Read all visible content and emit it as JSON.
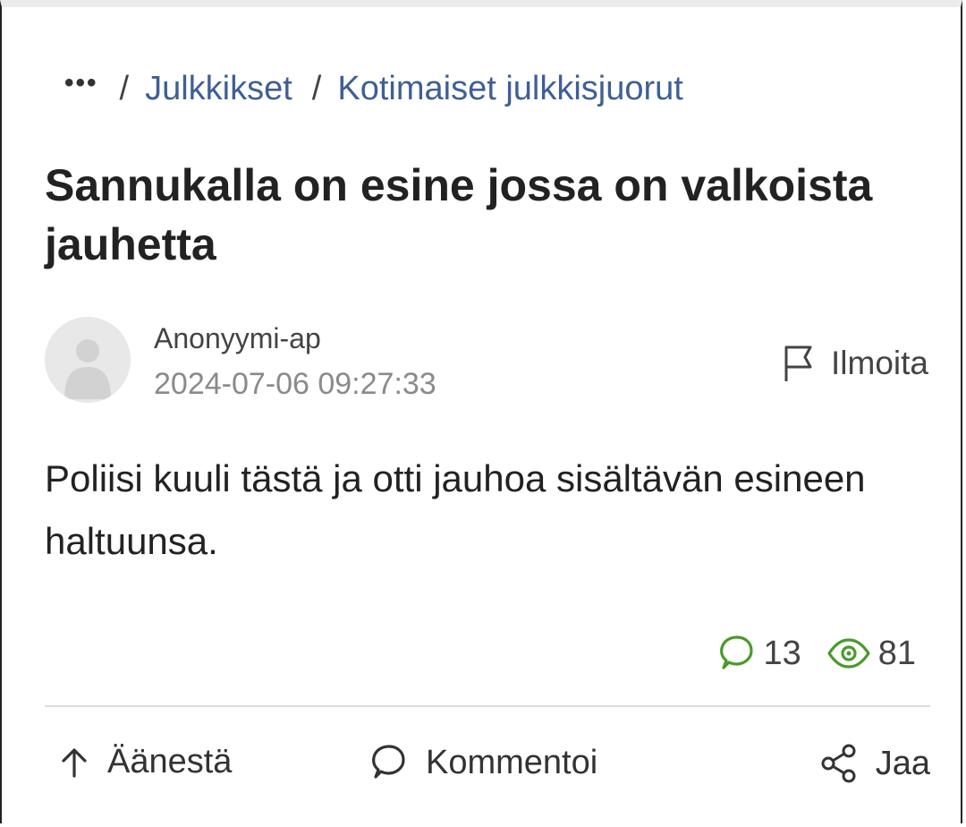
{
  "breadcrumb": {
    "more": "•••",
    "separator": "/",
    "items": [
      "Julkkikset",
      "Kotimaiset julkkisjuorut"
    ]
  },
  "post": {
    "title": "Sannukalla on esine jossa on valkoista jauhetta",
    "author": "Anonyymi-ap",
    "timestamp": "2024-07-06 09:27:33",
    "report_label": "Ilmoita",
    "body": "Poliisi kuuli tästä ja otti jauhoa sisältävän esineen haltuunsa.",
    "comment_count": "13",
    "view_count": "81"
  },
  "actions": {
    "vote_label": "Äänestä",
    "comment_label": "Kommentoi",
    "share_label": "Jaa"
  },
  "icons": {
    "more": "more-dots-icon",
    "report": "flag-icon",
    "comments": "speech-bubble-icon",
    "views": "eye-icon",
    "vote": "arrow-up-icon",
    "comment": "speech-bubble-icon",
    "share": "share-icon"
  },
  "colors": {
    "link": "#3f5f95",
    "stat_icon": "#4a9a2c",
    "text": "#222222",
    "muted": "#8a8a8a"
  }
}
